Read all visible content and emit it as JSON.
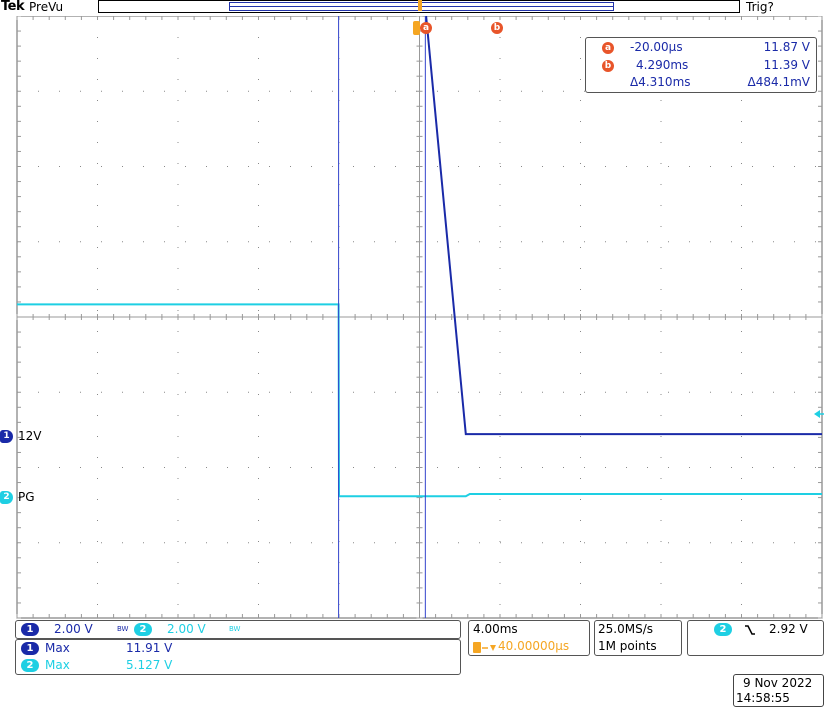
{
  "header": {
    "brand": "Tek",
    "status": "PreVu",
    "trigger_status": "Trig?"
  },
  "colors": {
    "ch1": "#1a2aa8",
    "ch2": "#1ecfe3",
    "cursor_badge": "#e8552a",
    "trigger": "#f5a623",
    "grid": "#888888"
  },
  "cursors": {
    "a_label": "a",
    "b_label": "b",
    "readout": {
      "a_time": "-20.00µs",
      "a_value": "11.87 V",
      "b_time": "4.290ms",
      "b_value": "11.39 V",
      "delta_time": "Δ4.310ms",
      "delta_value": "Δ484.1mV"
    }
  },
  "channels": [
    {
      "number": "1",
      "label": "12V"
    },
    {
      "number": "2",
      "label": "PG"
    }
  ],
  "settings": {
    "ch1_scale": "2.00 V",
    "ch1_bw": "BW",
    "ch2_scale": "2.00 V",
    "ch2_bw": "BW",
    "timebase": "4.00ms",
    "trigger_position": "40.00000µs",
    "sample_rate": "25.0MS/s",
    "record_length": "1M points",
    "trigger_source": "2",
    "trigger_slope_icon": "falling-edge-icon",
    "trigger_level": "2.92 V"
  },
  "measurements": [
    {
      "channel": "1",
      "name": "Max",
      "value": "11.91 V"
    },
    {
      "channel": "2",
      "name": "Max",
      "value": "5.127 V"
    }
  ],
  "datetime": {
    "date": "9 Nov 2022",
    "time": "14:58:55"
  },
  "chart_data": {
    "type": "line",
    "xlabel": "",
    "ylabel": "",
    "x_unit": "ms",
    "y_unit": "V",
    "xlim": [
      -16.0,
      24.0
    ],
    "x_divisions": 10,
    "y_divisions": 8,
    "grid": true,
    "series": [
      {
        "name": "12V",
        "channel": 1,
        "x": [
          -16.0,
          -0.02,
          4.2,
          4.29,
          6.3,
          24.0
        ],
        "y": [
          11.87,
          11.87,
          11.87,
          11.39,
          0.05,
          0.05
        ]
      },
      {
        "name": "PG",
        "channel": 2,
        "x": [
          -16.0,
          -0.02,
          0.0,
          6.3,
          6.5,
          24.0
        ],
        "y": [
          5.12,
          5.12,
          0.02,
          0.02,
          0.08,
          0.08
        ]
      }
    ],
    "cursors_x": [
      -0.02,
      4.29
    ]
  }
}
